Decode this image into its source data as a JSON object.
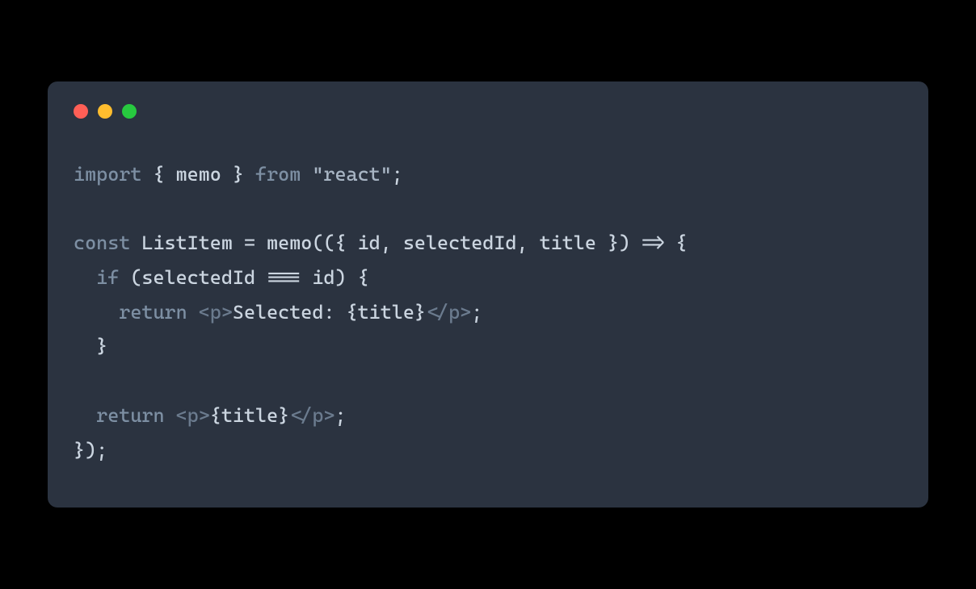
{
  "colors": {
    "background": "#000000",
    "window": "#2b3340",
    "red": "#ff5f56",
    "yellow": "#ffbd2e",
    "green": "#27c93f",
    "text": "#cbd5e0",
    "keyword": "#7d8fa3",
    "muted": "#6b7b8e"
  },
  "code": {
    "line1": {
      "t1": "import",
      "t2": " { ",
      "t3": "memo",
      "t4": " } ",
      "t5": "from",
      "t6": " ",
      "t7": "\"react\"",
      "t8": ";"
    },
    "line2": "",
    "line3": {
      "t1": "const",
      "t2": " ",
      "t3": "ListItem",
      "t4": " ",
      "t5": "=",
      "t6": " ",
      "t7": "memo",
      "t8": "(({ ",
      "t9": "id",
      "t10": ", ",
      "t11": "selectedId",
      "t12": ", ",
      "t13": "title",
      "t14": " }) ",
      "t15": "=>",
      "t16": " {"
    },
    "line4": {
      "t1": "  ",
      "t2": "if",
      "t3": " (",
      "t4": "selectedId",
      "t5": " ",
      "t6": "===",
      "t7": " ",
      "t8": "id",
      "t9": ") {"
    },
    "line5": {
      "t1": "    ",
      "t2": "return",
      "t3": " ",
      "t4": "<",
      "t5": "p",
      "t6": ">",
      "t7": "Selected: ",
      "t8": "{",
      "t9": "title",
      "t10": "}",
      "t11": "</",
      "t12": "p",
      "t13": ">",
      "t14": ";"
    },
    "line6": {
      "t1": "  }"
    },
    "line7": "",
    "line8": {
      "t1": "  ",
      "t2": "return",
      "t3": " ",
      "t4": "<",
      "t5": "p",
      "t6": ">",
      "t7": "{",
      "t8": "title",
      "t9": "}",
      "t10": "</",
      "t11": "p",
      "t12": ">",
      "t13": ";"
    },
    "line9": {
      "t1": "});"
    }
  }
}
